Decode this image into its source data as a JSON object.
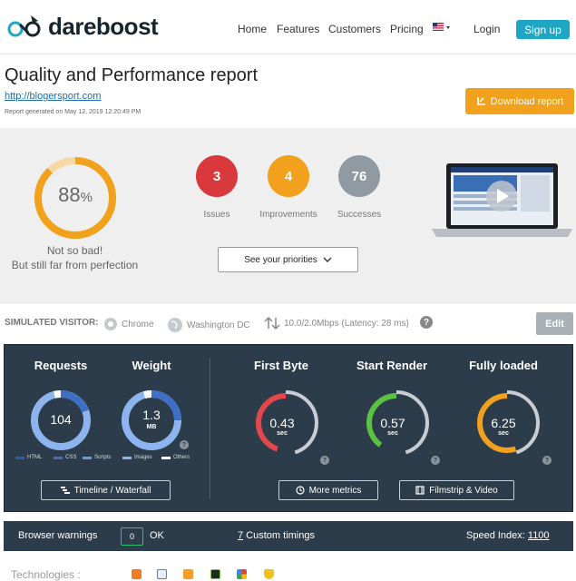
{
  "header": {
    "brand": "dareboost",
    "nav": [
      "Home",
      "Features",
      "Customers",
      "Pricing"
    ],
    "login": "Login",
    "signup": "Sign up"
  },
  "report": {
    "title": "Quality and Performance report",
    "url": "http://blogersport.com",
    "generated": "Report generated on May 12, 2019 12:20:49 PM",
    "download": "Download report"
  },
  "score": {
    "value": 88,
    "number": "88",
    "unit": "%",
    "verdict_line1": "Not so bad!",
    "verdict_line2": "But still far from perfection",
    "color": "#f1a11b"
  },
  "counts": [
    {
      "value": "3",
      "label": "Issues",
      "color": "#d9383c"
    },
    {
      "value": "4",
      "label": "Improvements",
      "color": "#f1a11b"
    },
    {
      "value": "76",
      "label": "Successes",
      "color": "#8f9aa2"
    }
  ],
  "priorities_label": "See your priorities",
  "visitor": {
    "title": "SIMULATED VISITOR:",
    "browser": "Chrome",
    "location": "Washington DC",
    "connection": "10.0/2.0Mbps (Latency: 28 ms)",
    "edit": "Edit"
  },
  "metrics": {
    "requests": {
      "title": "Requests",
      "value": "104"
    },
    "weight": {
      "title": "Weight",
      "value": "1.3",
      "unit": "MB"
    },
    "legend": [
      "HTML",
      "CSS",
      "Scripts",
      "Images",
      "Others"
    ],
    "timings": [
      {
        "title": "First Byte",
        "value": "0.43",
        "unit": "sec",
        "color": "#e2474c",
        "fill": 0.45
      },
      {
        "title": "Start Render",
        "value": "0.57",
        "unit": "sec",
        "color": "#5bc142",
        "fill": 0.4
      },
      {
        "title": "Fully loaded",
        "value": "6.25",
        "unit": "sec",
        "color": "#f1a11b",
        "fill": 0.55
      }
    ],
    "timeline_btn": "Timeline / Waterfall",
    "more_btn": "More metrics",
    "filmstrip_btn": "Filmstrip & Video"
  },
  "warnings": {
    "title": "Browser warnings",
    "count": "0",
    "ok": "OK",
    "custom_num": "7",
    "custom_text": " Custom timings",
    "speed_label": "Speed Index: ",
    "speed_value": "1100"
  },
  "technologies": {
    "label": "Technologies :",
    "icons": [
      "blogger-icon",
      "page-icon",
      "chart-icon",
      "l-icon",
      "google-icon",
      "shield-icon"
    ]
  }
}
